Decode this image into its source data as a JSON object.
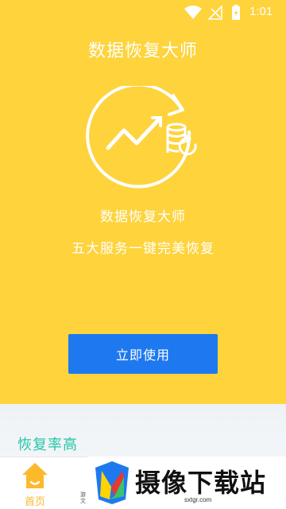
{
  "status_bar": {
    "time": "1:01",
    "icons": [
      "wifi-icon",
      "signal-icon",
      "battery-icon"
    ]
  },
  "hero": {
    "title": "数据恢复大师",
    "subtitle_1": "数据恢复大师",
    "subtitle_2": "五大服务一键完美恢复",
    "cta_label": "立即使用",
    "background": "#fed33c",
    "cta_color": "#1e79f0"
  },
  "section": {
    "title": "恢复率高",
    "color": "#25c6a5"
  },
  "bottom_nav": {
    "home_label": "首页",
    "more_label": "游文",
    "active_color": "#fcb92c"
  },
  "watermark": {
    "text": "摄像下载站",
    "url": "sxtgr.com"
  }
}
